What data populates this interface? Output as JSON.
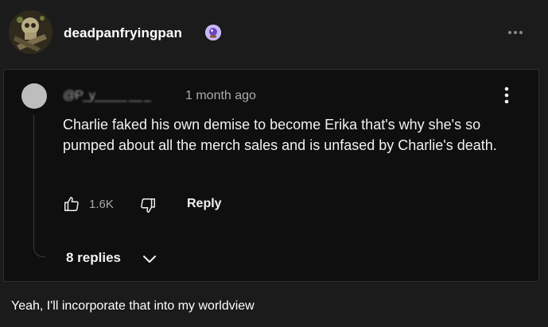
{
  "post": {
    "username": "deadpanfryingpan",
    "badge_icon": "crystal-ball-icon",
    "menu_icon": "more-horizontal-icon",
    "caption": "Yeah, I'll incorporate that into my worldview"
  },
  "comment": {
    "handle": "@P_y_____ __ _",
    "timestamp": "1 month ago",
    "text": "Charlie faked his own demise to become Erika that's why she's so pumped about all the merch sales and is unfased by Charlie's death.",
    "like_count": "1.6K",
    "reply_label": "Reply",
    "replies_label": "8 replies"
  },
  "colors": {
    "background": "#1b1b1b",
    "screenshot_background": "#0f0f0f",
    "secondary_text": "#aaaaaa",
    "badge": "#c9b8f5"
  }
}
